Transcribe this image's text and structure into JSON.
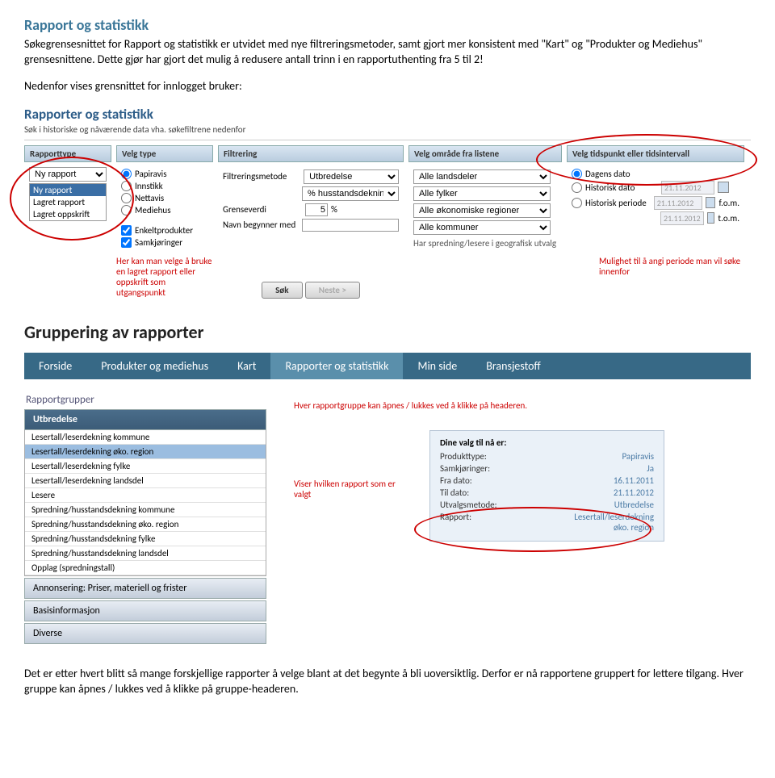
{
  "doc": {
    "title": "Rapport og statistikk",
    "para1": "Søkegrensesnittet for Rapport og statistikk er utvidet med nye filtreringsmetoder, samt gjort mer konsistent med \"Kart\" og \"Produkter og Mediehus\" grensesnittene. Dette gjør har gjort det mulig å redusere antall trinn i en rapportuthenting fra 5 til 2!",
    "para2": "Nedenfor vises grensnittet for innlogget bruker:",
    "section2_heading": "Gruppering av rapporter",
    "para3": "Det er etter hvert blitt så mange forskjellige rapporter å velge blant at det begynte å bli uoversiktlig. Derfor er nå rapportene gruppert for lettere tilgang. Hver gruppe kan åpnes / lukkes ved å klikke på gruppe-headeren."
  },
  "app1": {
    "title": "Rapporter og statistikk",
    "subtitle": "Søk i historiske og nåværende data vha. søkefiltrene nedenfor",
    "col1_header": "Rapporttype",
    "col1_options": [
      "Ny rapport",
      "Ny rapport",
      "Lagret rapport",
      "Lagret oppskrift"
    ],
    "col2_header": "Velg type",
    "col2_radios": [
      "Papiravis",
      "Innstikk",
      "Nettavis",
      "Mediehus"
    ],
    "col2_checks": [
      "Enkeltprodukter",
      "Samkjøringer"
    ],
    "col3_header": "Filtrering",
    "col3_label1": "Filtreringsmetode",
    "col3_sel1": "Utbredelse",
    "col3_sel2": "% husstandsdekning",
    "col3_label2": "Grenseverdi",
    "col3_val2": "5",
    "col3_unit": "%",
    "col3_label3": "Navn begynner med",
    "col4_header": "Velg område fra listene",
    "col4_sel1": "Alle landsdeler",
    "col4_sel2": "Alle fylker",
    "col4_sel3": "Alle økonomiske regioner",
    "col4_sel4": "Alle kommuner",
    "col4_note": "Har spredning/lesere i geografisk utvalg",
    "col5_header": "Velg tidspunkt eller tidsintervall",
    "col5_r1": "Dagens dato",
    "col5_r2": "Historisk dato",
    "col5_r3": "Historisk periode",
    "col5_date": "21.11.2012",
    "col5_fom": "f.o.m.",
    "col5_tom": "t.o.m.",
    "annot1": "Her kan man velge å bruke en lagret rapport eller oppskrift som utgangspunkt",
    "annot2": "Mulighet til å angi periode man vil søke innenfor",
    "btn_search": "Søk",
    "btn_next": "Neste >"
  },
  "app2": {
    "nav": [
      "Forside",
      "Produkter og mediehus",
      "Kart",
      "Rapporter og statistikk",
      "Min side",
      "Bransjestoff"
    ],
    "groups_title": "Rapportgrupper",
    "group_expanded": "Utbredelse",
    "group_items": [
      "Lesertall/leserdekning kommune",
      "Lesertall/leserdekning øko. region",
      "Lesertall/leserdekning fylke",
      "Lesertall/leserdekning landsdel",
      "Lesere",
      "Spredning/husstandsdekning kommune",
      "Spredning/husstandsdekning øko. region",
      "Spredning/husstandsdekning fylke",
      "Spredning/husstandsdekning landsdel",
      "Opplag (spredningstall)"
    ],
    "group_collapsed": [
      "Annonsering: Priser, materiell og frister",
      "Basisinformasjon",
      "Diverse"
    ],
    "annot1": "Hver rapportgruppe kan åpnes / lukkes ved å klikke på headeren.",
    "annot2": "Viser hvilken rapport som er valgt",
    "summary_title": "Dine valg til nå er:",
    "summary_rows": [
      {
        "label": "Produkttype:",
        "value": "Papiravis"
      },
      {
        "label": "Samkjøringer:",
        "value": "Ja"
      },
      {
        "label": "Fra dato:",
        "value": "16.11.2011"
      },
      {
        "label": "Til dato:",
        "value": "21.11.2012"
      },
      {
        "label": "Utvalgsmetode:",
        "value": "Utbredelse"
      },
      {
        "label": "Rapport:",
        "value": "Lesertall/leserdekning øko. region"
      }
    ]
  }
}
